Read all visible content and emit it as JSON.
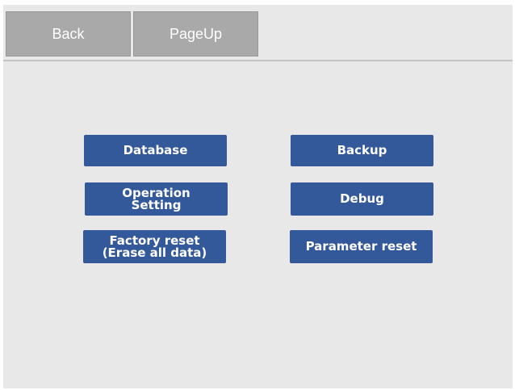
{
  "topbar": {
    "back_label": "Back",
    "pageup_label": "PageUp"
  },
  "menu": {
    "database": "Database",
    "backup": "Backup",
    "operation_line1": "Operation",
    "operation_line2": "Setting",
    "debug": "Debug",
    "factory_line1": "Factory reset",
    "factory_line2": "(Erase all data)",
    "parameter_reset": "Parameter reset"
  },
  "colors": {
    "menu_button": "#34599a",
    "nav_button": "#a9a9a9",
    "background": "#e8e8e8"
  }
}
